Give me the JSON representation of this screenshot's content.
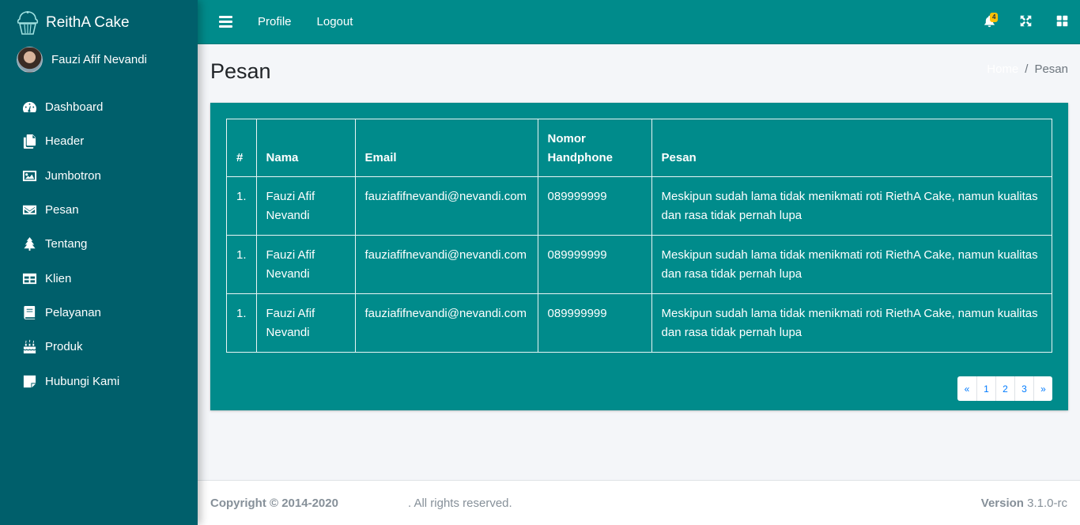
{
  "brand": {
    "name": "ReithA Cake"
  },
  "user": {
    "name": "Fauzi Afif Nevandi"
  },
  "sidebar": {
    "items": [
      {
        "label": "Dashboard",
        "icon": "tachometer-icon"
      },
      {
        "label": "Header",
        "icon": "copy-icon"
      },
      {
        "label": "Jumbotron",
        "icon": "image-icon"
      },
      {
        "label": "Pesan",
        "icon": "envelope-icon"
      },
      {
        "label": "Tentang",
        "icon": "tree-icon"
      },
      {
        "label": "Klien",
        "icon": "table-icon"
      },
      {
        "label": "Pelayanan",
        "icon": "book-icon"
      },
      {
        "label": "Produk",
        "icon": "birthday-cake-icon"
      },
      {
        "label": "Hubungi Kami",
        "icon": "sticky-note-icon"
      }
    ]
  },
  "topbar": {
    "links": [
      "Profile",
      "Logout"
    ],
    "notification_count": "4"
  },
  "header": {
    "title": "Pesan",
    "breadcrumb": {
      "home": "Home",
      "separator": "/",
      "active": "Pesan"
    }
  },
  "table": {
    "columns": [
      "#",
      "Nama",
      "Email",
      "Nomor Handphone",
      "Pesan"
    ],
    "rows": [
      {
        "no": "1.",
        "nama": "Fauzi Afif Nevandi",
        "email": "fauziafifnevandi@nevandi.com",
        "hp": "089999999",
        "pesan": "Meskipun sudah lama tidak menikmati roti RiethA Cake, namun kualitas dan rasa tidak pernah lupa"
      },
      {
        "no": "1.",
        "nama": "Fauzi Afif Nevandi",
        "email": "fauziafifnevandi@nevandi.com",
        "hp": "089999999",
        "pesan": "Meskipun sudah lama tidak menikmati roti RiethA Cake, namun kualitas dan rasa tidak pernah lupa"
      },
      {
        "no": "1.",
        "nama": "Fauzi Afif Nevandi",
        "email": "fauziafifnevandi@nevandi.com",
        "hp": "089999999",
        "pesan": "Meskipun sudah lama tidak menikmati roti RiethA Cake, namun kualitas dan rasa tidak pernah lupa"
      }
    ]
  },
  "pagination": {
    "prev": "«",
    "pages": [
      "1",
      "2",
      "3"
    ],
    "next": "»"
  },
  "footer": {
    "copyright": "Copyright © 2014-2020",
    "rights": ". All rights reserved.",
    "version_label": "Version",
    "version_value": "3.1.0-rc"
  },
  "colors": {
    "sidebar": "#005f6b",
    "topbar": "#008b8b",
    "card": "#008b8b",
    "badge": "#ffc107"
  }
}
